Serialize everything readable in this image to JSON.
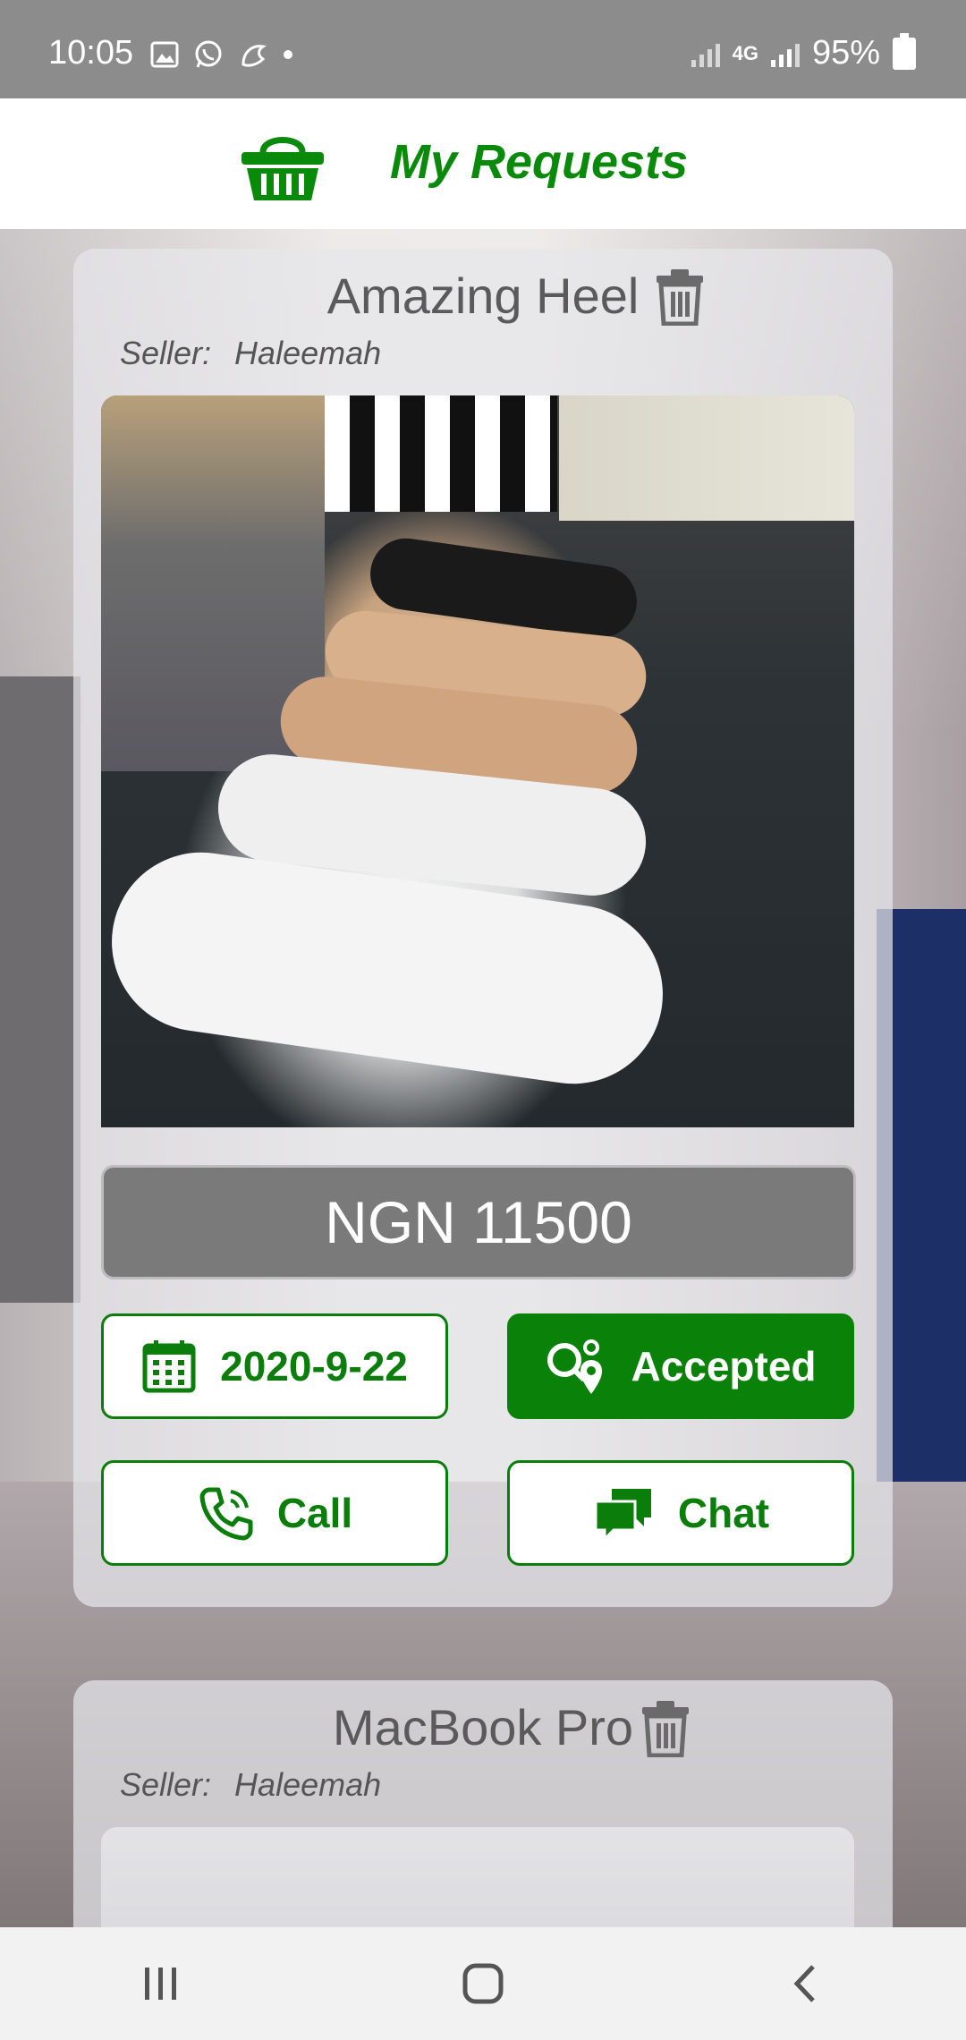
{
  "status_bar": {
    "time": "10:05",
    "battery": "95%",
    "network": "4G"
  },
  "header": {
    "title": "My Requests",
    "icon": "basket-icon"
  },
  "requests": [
    {
      "title": "Amazing Heel",
      "seller_label": "Seller:",
      "seller": "Haleemah",
      "price": "NGN 11500",
      "date": "2020-9-22",
      "status": "Accepted",
      "call_label": "Call",
      "chat_label": "Chat"
    },
    {
      "title": "MacBook Pro",
      "seller_label": "Seller:",
      "seller": "Haleemah"
    }
  ],
  "colors": {
    "accent": "#0a820a",
    "price_bg": "#7a7a7a"
  }
}
